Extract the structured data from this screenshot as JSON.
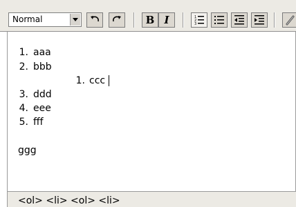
{
  "toolbar": {
    "format_value": "Normal",
    "bold_label": "B",
    "italic_label": "I"
  },
  "content": {
    "list": [
      {
        "num": "1.",
        "text": "aaa"
      },
      {
        "num": "2.",
        "text": "bbb"
      }
    ],
    "nested": [
      {
        "num": "1.",
        "text": "ccc"
      }
    ],
    "list_cont": [
      {
        "num": "3.",
        "text": "ddd"
      },
      {
        "num": "4.",
        "text": "eee"
      },
      {
        "num": "5.",
        "text": "fff"
      }
    ],
    "paragraph": "ggg"
  },
  "statusbar": {
    "path": "<ol> <li> <ol> <li>"
  },
  "icons": {
    "undo": "undo-icon",
    "redo": "redo-icon",
    "ordered_list": "ordered-list-icon",
    "unordered_list": "unordered-list-icon",
    "outdent": "outdent-icon",
    "indent": "indent-icon",
    "link": "link-icon"
  }
}
